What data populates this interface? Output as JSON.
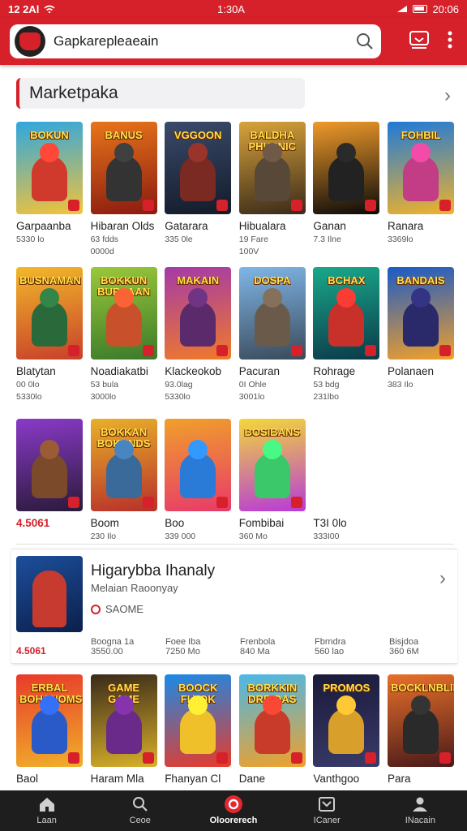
{
  "status": {
    "time": "12 2Al",
    "center": "1:30A",
    "right": "20:06"
  },
  "search": {
    "value": "Gapkarepleaeain"
  },
  "section": {
    "title": "Marketpaka"
  },
  "row1": [
    {
      "title": "BOKUN",
      "name": "Garpaanba",
      "sub1": "5330 lo",
      "sub2": "",
      "g1": "#2ea7e0",
      "g2": "#f3c33a",
      "fig": "#d03a2c"
    },
    {
      "title": "BANUS",
      "name": "Hibaran Olds",
      "sub1": "63 fdds",
      "sub2": "0000d",
      "g1": "#e8751a",
      "g2": "#8a1a10",
      "fig": "#333"
    },
    {
      "title": "VGGOON",
      "name": "Gatarara",
      "sub1": "335 0le",
      "sub2": "",
      "g1": "#3a4a6a",
      "g2": "#131b2a",
      "fig": "#7a2a22"
    },
    {
      "title": "BALDHA PHUSNIC",
      "name": "Hibualara",
      "sub1": "19 Fare",
      "sub2": "100V",
      "g1": "#d8a33a",
      "g2": "#3a2a1a",
      "fig": "#584838"
    },
    {
      "title": "",
      "name": "Ganan",
      "sub1": "7.3 Ilne",
      "sub2": "",
      "g1": "#f09a2a",
      "g2": "#0a0a0a",
      "fig": "#222"
    },
    {
      "title": "FOHBIL",
      "name": "Ranara",
      "sub1": "3369lo",
      "sub2": "",
      "g1": "#1f7ad8",
      "g2": "#f0b22c",
      "fig": "#c23c86"
    }
  ],
  "row2": [
    {
      "title": "BUSNAMAN",
      "name": "Blatytan",
      "sub1": "00 0lo",
      "sub2": "5330lo",
      "g1": "#f2b82a",
      "g2": "#c8402a",
      "fig": "#2a6a3a"
    },
    {
      "title": "BOKKUN BURSAAN",
      "name": "Noadiakatbi",
      "sub1": "53 bula",
      "sub2": "3000lo",
      "g1": "#9ac83a",
      "g2": "#3a7a2a",
      "fig": "#c8502a"
    },
    {
      "title": "MAKAIN",
      "name": "Klackeokob",
      "sub1": "93.0lag",
      "sub2": "5330lo",
      "g1": "#a43aa8",
      "g2": "#f07a2a",
      "fig": "#5a2a6a"
    },
    {
      "title": "DOSPA",
      "name": "Pacuran",
      "sub1": "0I Ohle",
      "sub2": "3001lo",
      "g1": "#7fb6e8",
      "g2": "#3a4a5a",
      "fig": "#6a5a4a"
    },
    {
      "title": "BCHAX",
      "name": "Rohrage",
      "sub1": "53 bdg",
      "sub2": "231lbo",
      "g1": "#1aa88a",
      "g2": "#0a3a4a",
      "fig": "#c8302a"
    },
    {
      "title": "BANDAIS",
      "name": "Polanaen",
      "sub1": "383 Ilo",
      "sub2": "",
      "g1": "#1a5ac8",
      "g2": "#f0a02a",
      "fig": "#2a2a6a"
    }
  ],
  "row3": [
    {
      "title": "",
      "name": "4.5061",
      "sub1": "",
      "sub2": "",
      "g1": "#8a3ac8",
      "g2": "#2a1a3a",
      "fig": "#7a4a2a",
      "red": true
    },
    {
      "title": "BOKKAN BOKUNDS",
      "name": "Boom",
      "sub1": "230 Ilo",
      "sub2": "",
      "g1": "#e8b02a",
      "g2": "#b8302a",
      "fig": "#3a6a9a"
    },
    {
      "title": "",
      "name": "Boo",
      "sub1": "339 000",
      "sub2": "",
      "g1": "#f0a02a",
      "g2": "#e83a6a",
      "fig": "#2a7ad8"
    },
    {
      "title": "BOSIBANS",
      "name": "Fombibai",
      "sub1": "360 Mo",
      "sub2": "",
      "g1": "#f2d83a",
      "g2": "#b83ad8",
      "fig": "#3ac86a"
    },
    {
      "title": "",
      "name": "T3I 0lo",
      "sub1": "333I00",
      "sub2": "",
      "empty": true
    }
  ],
  "feature": {
    "title": "Higarybba Ihanaly",
    "subtitle": "Melaian Raoonyay",
    "badge": "SAOME",
    "rating": "4.5061",
    "stats": [
      {
        "a": "Boogna 1a",
        "b": "3550.00"
      },
      {
        "a": "Foee Iba",
        "b": "7250 Mo"
      },
      {
        "a": "Frenbola",
        "b": "840 Ma"
      },
      {
        "a": "Fbrndra",
        "b": "560 lao"
      },
      {
        "a": "Bisjdoa",
        "b": "360 6M"
      }
    ]
  },
  "row5": [
    {
      "title": "ERBAL BOHANOMS",
      "name": "Baol",
      "sub1": "",
      "g1": "#e83a2a",
      "g2": "#f0b02a",
      "fig": "#2a5ac8"
    },
    {
      "title": "GAME GAME",
      "name": "Haram Mla",
      "sub1": "",
      "g1": "#3a2a1a",
      "g2": "#d8b02a",
      "fig": "#6a2a8a"
    },
    {
      "title": "BOOCK FLYOK",
      "name": "Fhanyan Cl",
      "sub1": "",
      "g1": "#1a8ae8",
      "g2": "#e83a2a",
      "fig": "#f0c02a"
    },
    {
      "title": "BORKKIN DRBIDAS",
      "name": "Dane",
      "sub1": "",
      "g1": "#4ab8e8",
      "g2": "#f0a02a",
      "fig": "#c83a2a"
    },
    {
      "title": "PROMOS",
      "name": "Vanthgoo",
      "sub1": "",
      "g1": "#1a1a3a",
      "g2": "#3a3a6a",
      "fig": "#d8a02a"
    },
    {
      "title": "BOCKLNBLINI",
      "name": "Para",
      "sub1": "",
      "g1": "#e8702a",
      "g2": "#4a1a1a",
      "fig": "#2a2a2a"
    }
  ],
  "nav": [
    {
      "label": "Laan",
      "icon": "home-icon",
      "active": false
    },
    {
      "label": "Ceoe",
      "icon": "search-icon",
      "active": false
    },
    {
      "label": "Oloorerech",
      "icon": "store-icon",
      "active": true
    },
    {
      "label": "ICaner",
      "icon": "inbox-icon",
      "active": false
    },
    {
      "label": "INacain",
      "icon": "person-icon",
      "active": false
    }
  ]
}
